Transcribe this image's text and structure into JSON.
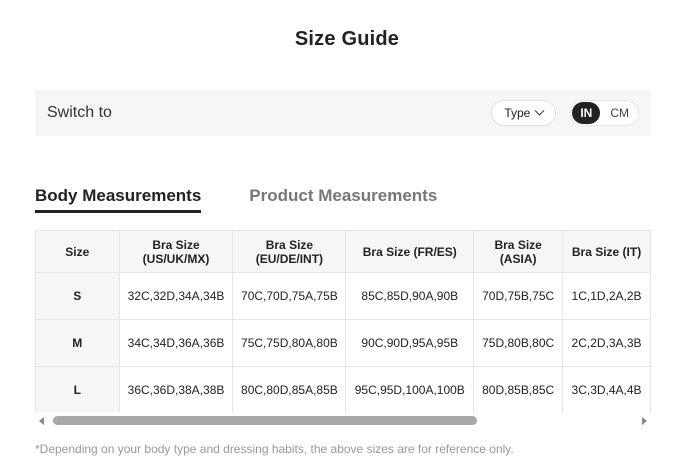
{
  "title": "Size Guide",
  "switch_bar": {
    "label": "Switch to",
    "type_label": "Type",
    "units": [
      "IN",
      "CM"
    ],
    "active_unit": "IN"
  },
  "tabs": [
    "Body Measurements",
    "Product Measurements"
  ],
  "active_tab": "Body Measurements",
  "table": {
    "headers": [
      [
        "Size"
      ],
      [
        "Bra Size",
        "(US/UK/MX)"
      ],
      [
        "Bra Size",
        "(EU/DE/INT)"
      ],
      [
        "Bra Size (FR/ES)"
      ],
      [
        "Bra Size",
        "(ASIA)"
      ],
      [
        "Bra Size (IT)"
      ]
    ],
    "rows": [
      [
        "S",
        "32C,32D,34A,34B",
        "70C,70D,75A,75B",
        "85C,85D,90A,90B",
        "70D,75B,75C",
        "1C,1D,2A,2B"
      ],
      [
        "M",
        "34C,34D,36A,36B",
        "75C,75D,80A,80B",
        "90C,90D,95A,95B",
        "75D,80B,80C",
        "2C,2D,3A,3B"
      ],
      [
        "L",
        "36C,36D,38A,38B",
        "80C,80D,85A,85B",
        "95C,95D,100A,100B",
        "80D,85B,85C",
        "3C,3D,4A,4B"
      ]
    ]
  },
  "footnote": "*Depending on your body type and dressing habits, the above sizes are for reference only."
}
